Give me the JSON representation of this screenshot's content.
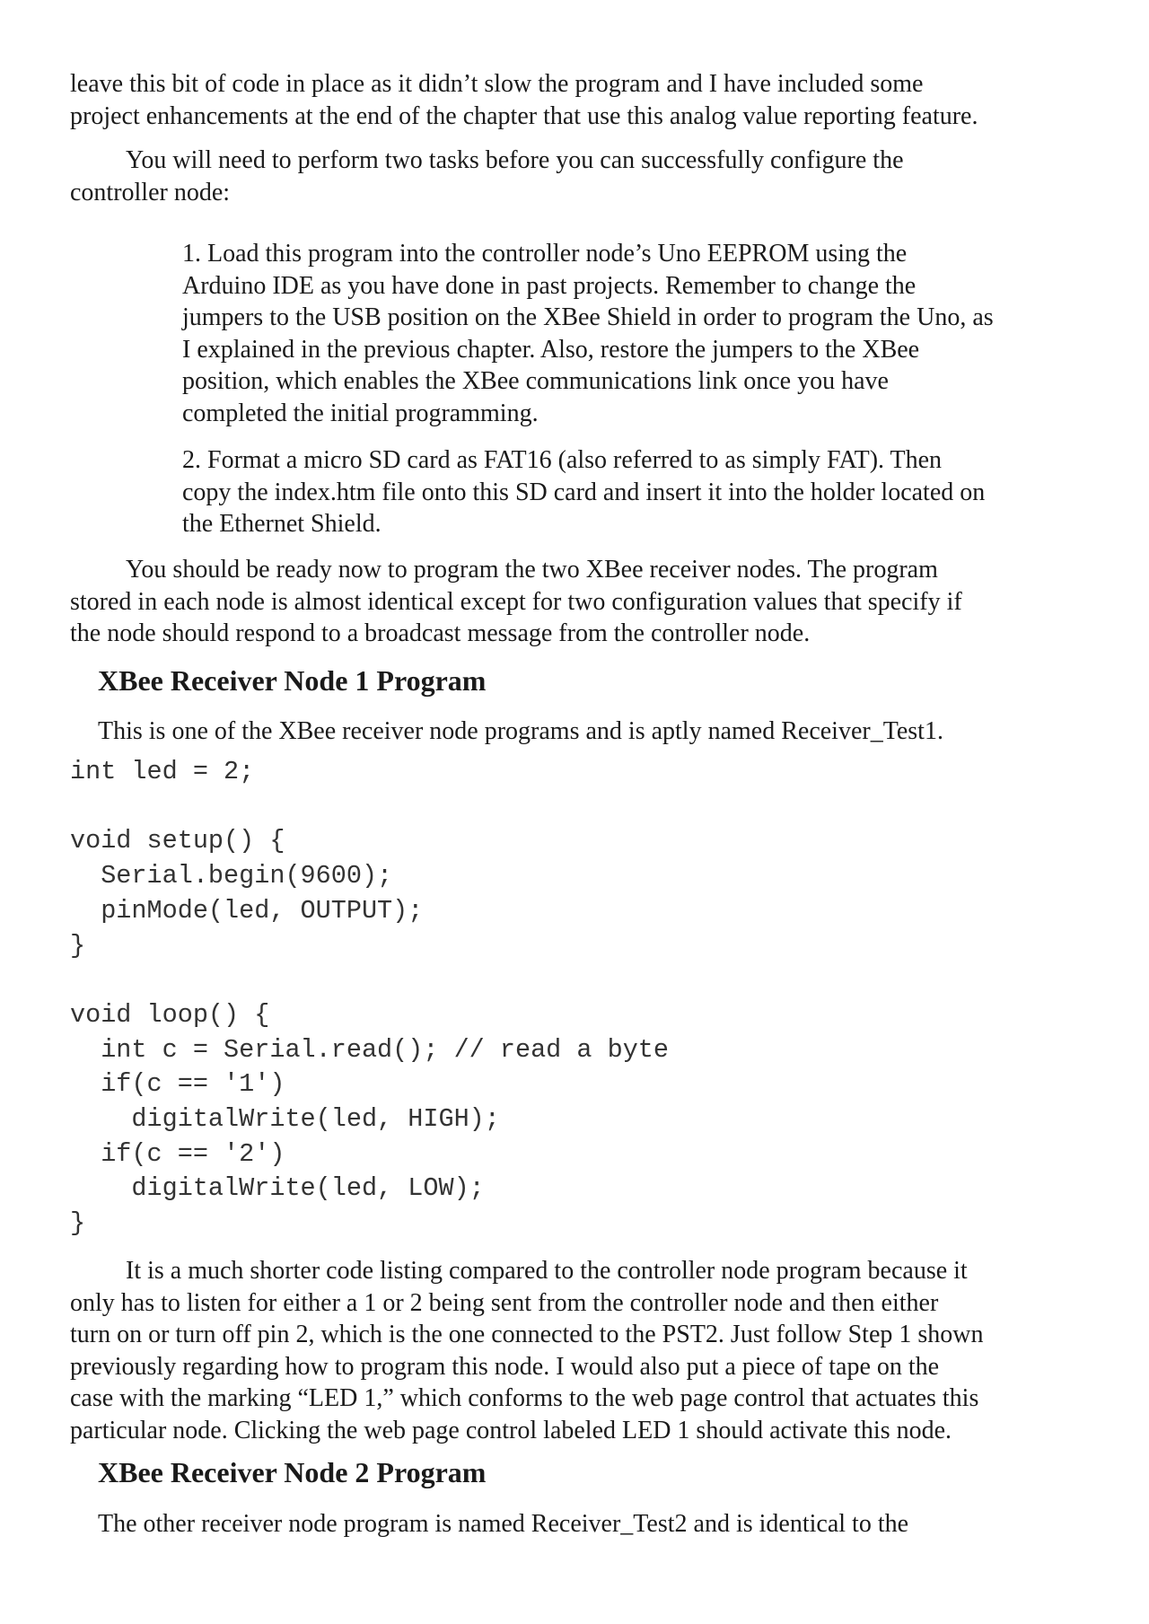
{
  "para_intro": [
    "leave this bit of code in place as it didn’t slow the program and I have included some",
    "project enhancements at the end of the chapter that use this analog value reporting feature."
  ],
  "para_tasks": [
    "You will need to perform two tasks before you can successfully configure the",
    "controller node:"
  ],
  "steps": [
    {
      "lines": [
        "1. Load this program into the controller node’s Uno EEPROM using the",
        "Arduino IDE as you have done in past projects. Remember to change the",
        "jumpers to the USB position on the XBee Shield in order to program the Uno, as",
        "I explained in the previous chapter. Also, restore the jumpers to the XBee",
        "position, which enables the XBee communications link once you have",
        "completed the initial programming."
      ]
    },
    {
      "lines": [
        "2. Format a micro SD card as FAT16 (also referred to as simply FAT). Then",
        "copy the index.htm file onto this SD card and insert it into the holder located on",
        "the Ethernet Shield."
      ]
    }
  ],
  "para_ready": [
    "You should be ready now to program the two XBee receiver nodes. The program",
    "stored in each node is almost identical except for two configuration values that specify if",
    "the node should respond to a broadcast message from the controller node."
  ],
  "section1": {
    "heading": "XBee Receiver Node 1 Program",
    "lead": "This is one of the XBee receiver node programs and is aptly named Receiver_Test1."
  },
  "code_listing": [
    "int led = 2;",
    "",
    "void setup() {",
    "  Serial.begin(9600);",
    "  pinMode(led, OUTPUT);",
    "}",
    "",
    "void loop() {",
    "  int c = Serial.read(); // read a byte",
    "  if(c == '1')",
    "    digitalWrite(led, HIGH);",
    "  if(c == '2')",
    "    digitalWrite(led, LOW);",
    "}"
  ],
  "para_shorter": [
    "It is a much shorter code listing compared to the controller node program because it",
    "only has to listen for either a 1 or 2 being sent from the controller node and then either",
    "turn on or turn off pin 2, which is the one connected to the PST2. Just follow Step 1 shown",
    "previously regarding how to program this node. I would also put a piece of tape on the",
    "case with the marking “LED 1,” which conforms to the web page control that actuates this",
    "particular node. Clicking the web page control labeled LED 1 should activate this node."
  ],
  "section2": {
    "heading": "XBee Receiver Node 2 Program",
    "lead": "The other receiver node program is named Receiver_Test2 and is identical to the"
  }
}
